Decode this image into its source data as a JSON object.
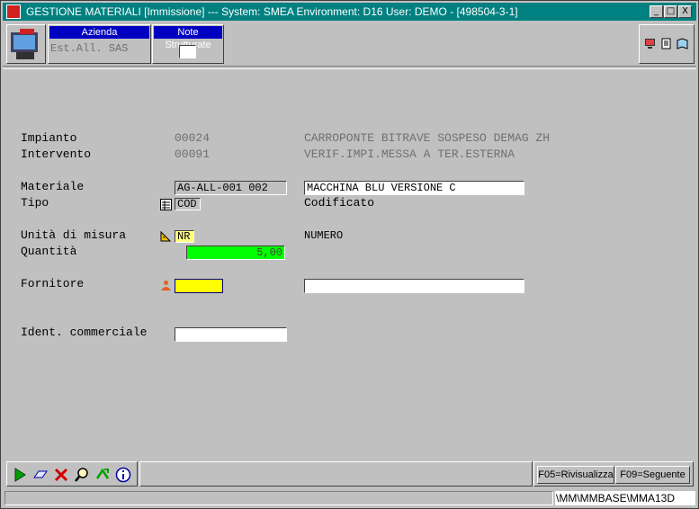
{
  "window": {
    "title": "GESTIONE MATERIALI [Immissione] --- System: SMEA Environment: D16 User: DEMO - [498504-3-1]",
    "controls": {
      "minimize": "_",
      "maximize": "□",
      "close": "X"
    }
  },
  "header": {
    "azienda_label": "Azienda",
    "azienda_value": "Est.All. SAS",
    "note_label": "Note Strutturate"
  },
  "form": {
    "impianto": {
      "label": "Impianto",
      "code": "00024",
      "description": "CARROPONTE BITRAVE SOSPESO DEMAG ZH"
    },
    "intervento": {
      "label": "Intervento",
      "code": "00091",
      "description": "VERIF.IMPI.MESSA A TER.ESTERNA"
    },
    "materiale": {
      "label": "Materiale",
      "code": "AG-ALL-001   002",
      "description": "MACCHINA BLU VERSIONE C"
    },
    "tipo": {
      "label": "Tipo",
      "code": "COD",
      "description": "Codificato"
    },
    "unita": {
      "label": "Unità di misura",
      "code": "NR",
      "description": "NUMERO"
    },
    "quantita": {
      "label": "Quantità",
      "value": "5,00"
    },
    "fornitore": {
      "label": "Fornitore",
      "code": "",
      "description": ""
    },
    "ident": {
      "label": "Ident. commerciale",
      "value": ""
    }
  },
  "bottom": {
    "f05": "F05=Rivisualizza",
    "f09": "F09=Seguente"
  },
  "status": {
    "path": "\\MM\\MMBASE\\MMA13D"
  },
  "colors": {
    "titlebar": "#008080",
    "header_label": "#0000c0",
    "quantity_bg": "#00ff00",
    "fornitore_bg": "#ffff00",
    "code_badge_bg": "#ffff80"
  }
}
